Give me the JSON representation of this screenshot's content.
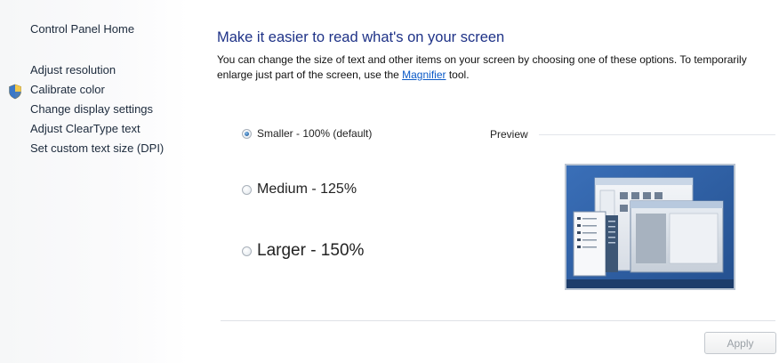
{
  "sidebar": {
    "home_link": "Control Panel Home",
    "items": [
      {
        "label": "Adjust resolution"
      },
      {
        "label": "Calibrate color",
        "icon": "shield-icon"
      },
      {
        "label": "Change display settings"
      },
      {
        "label": "Adjust ClearType text"
      },
      {
        "label": "Set custom text size (DPI)"
      }
    ]
  },
  "main": {
    "title": "Make it easier to read what's on your screen",
    "description_before": "You can change the size of text and other items on your screen by choosing one of these options. To temporarily enlarge just part of the screen, use the",
    "magnifier_link": "Magnifier",
    "description_after": "tool.",
    "options": [
      {
        "label": "Smaller - 100% (default)",
        "selected": true
      },
      {
        "label": "Medium - 125%",
        "selected": false
      },
      {
        "label": "Larger - 150%",
        "selected": false
      }
    ],
    "preview_label": "Preview",
    "apply_button": "Apply"
  },
  "colors": {
    "title": "#1e3287",
    "link": "#0a59c7",
    "preview_background": "#2e5fa8"
  }
}
